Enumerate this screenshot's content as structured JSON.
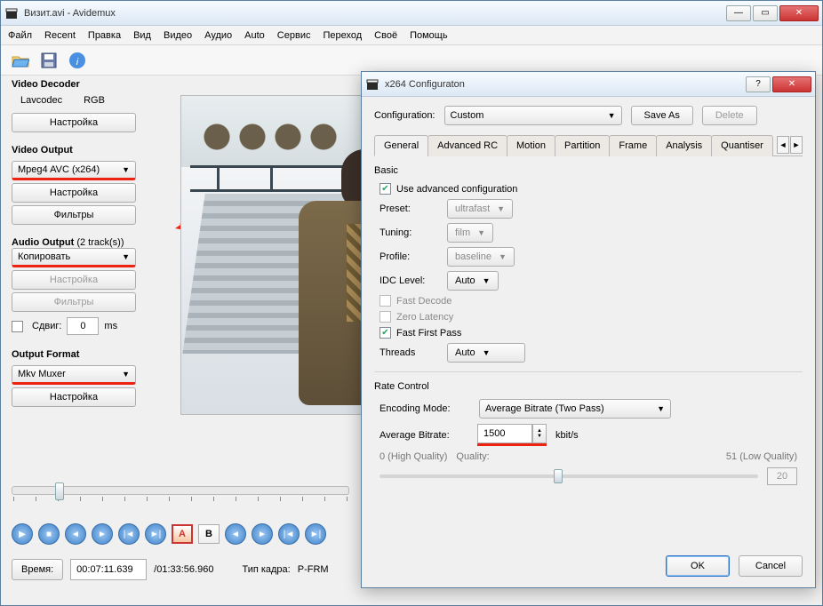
{
  "window": {
    "title": "Визит.avi - Avidemux"
  },
  "menu": {
    "file": "Файл",
    "recent": "Recent",
    "edit": "Правка",
    "view": "Вид",
    "video": "Видео",
    "audio": "Аудио",
    "auto": "Auto",
    "service": "Сервис",
    "goto": "Переход",
    "own": "Своё",
    "help": "Помощь"
  },
  "decoder": {
    "title": "Video Decoder",
    "codec": "Lavcodec",
    "color": "RGB",
    "settings": "Настройка"
  },
  "video_out": {
    "title": "Video Output",
    "select": "Mpeg4 AVC (x264)",
    "settings": "Настройка",
    "filters": "Фильтры"
  },
  "audio_out": {
    "title": "Audio Output",
    "tracks": "(2 track(s))",
    "select": "Копировать",
    "settings": "Настройка",
    "filters": "Фильтры",
    "shift_label": "Сдвиг:",
    "shift_value": "0",
    "shift_unit": "ms"
  },
  "out_fmt": {
    "title": "Output Format",
    "select": "Mkv Muxer",
    "settings": "Настройка"
  },
  "status": {
    "time_label": "Время:",
    "time_value": "00:07:11.639",
    "duration": "/01:33:56.960",
    "frame_label": "Тип кадра:",
    "frame_type": "P-FRM"
  },
  "dialog": {
    "title": "x264 Configuraton",
    "config_label": "Configuration:",
    "config_value": "Custom",
    "save_as": "Save As",
    "delete": "Delete",
    "tabs": {
      "general": "General",
      "adv": "Advanced RC",
      "motion": "Motion",
      "partition": "Partition",
      "frame": "Frame",
      "analysis": "Analysis",
      "quant": "Quantiser"
    },
    "basic": {
      "title": "Basic",
      "use_adv": "Use advanced configuration",
      "preset_label": "Preset:",
      "preset_value": "ultrafast",
      "tuning_label": "Tuning:",
      "tuning_value": "film",
      "profile_label": "Profile:",
      "profile_value": "baseline",
      "idc_label": "IDC Level:",
      "idc_value": "Auto",
      "fast_decode": "Fast Decode",
      "zero_latency": "Zero Latency",
      "fast_first_pass": "Fast First Pass",
      "threads_label": "Threads",
      "threads_value": "Auto"
    },
    "rate": {
      "title": "Rate Control",
      "enc_mode_label": "Encoding Mode:",
      "enc_mode_value": "Average Bitrate (Two Pass)",
      "bitrate_label": "Average Bitrate:",
      "bitrate_value": "1500",
      "bitrate_unit": "kbit/s",
      "q_high": "0 (High Quality)",
      "q_label": "Quality:",
      "q_low": "51 (Low Quality)",
      "q_value": "20"
    },
    "ok": "OK",
    "cancel": "Cancel"
  }
}
